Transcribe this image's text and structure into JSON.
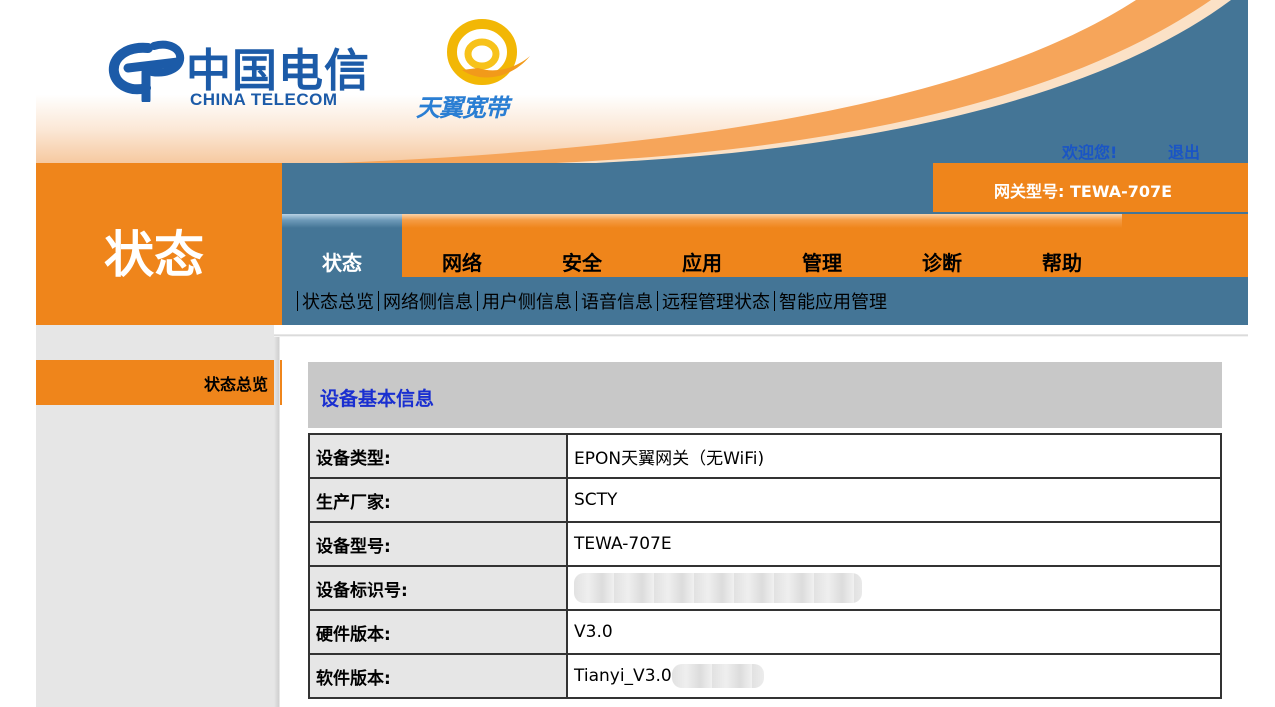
{
  "header": {
    "brand_cn": "中国电信",
    "brand_en": "CHINA TELECOM",
    "sub_brand": "天翼宽带",
    "welcome": "欢迎您!",
    "logout": "退出"
  },
  "section_title": "状态",
  "gateway": {
    "label": "网关型号: TEWA-707E"
  },
  "tabs": [
    {
      "label": "状态",
      "active": true
    },
    {
      "label": "网络",
      "active": false
    },
    {
      "label": "安全",
      "active": false
    },
    {
      "label": "应用",
      "active": false
    },
    {
      "label": "管理",
      "active": false
    },
    {
      "label": "诊断",
      "active": false
    },
    {
      "label": "帮助",
      "active": false
    }
  ],
  "subnav": [
    "状态总览",
    "网络侧信息",
    "用户侧信息",
    "语音信息",
    "远程管理状态",
    "智能应用管理"
  ],
  "sidebar": {
    "items": [
      {
        "label": "状态总览",
        "active": true
      }
    ]
  },
  "main": {
    "title": "设备基本信息",
    "rows": [
      {
        "key": "设备类型:",
        "value": "EPON天翼网关（无WiFi)"
      },
      {
        "key": "生产厂家:",
        "value": "SCTY"
      },
      {
        "key": "设备型号:",
        "value": "TEWA-707E"
      },
      {
        "key": "设备标识号:",
        "value": ""
      },
      {
        "key": "硬件版本:",
        "value": "V3.0"
      },
      {
        "key": "软件版本:",
        "value": "Tianyi_V3.0"
      }
    ]
  },
  "colors": {
    "orange": "#ef851b",
    "blue": "#447596",
    "link": "#1a55c5",
    "title_blue": "#1a2fd0"
  }
}
